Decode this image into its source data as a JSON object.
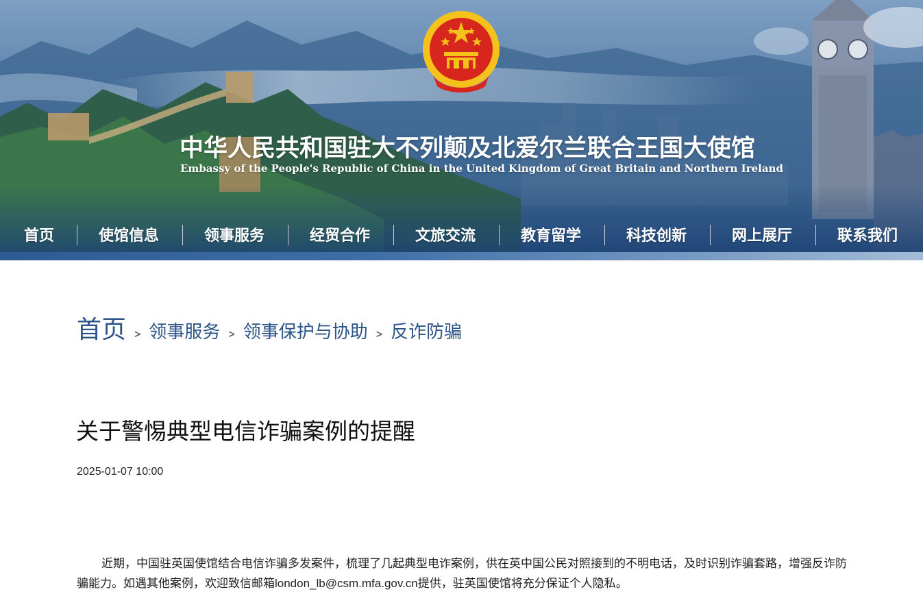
{
  "header": {
    "title_cn": "中华人民共和国驻大不列颠及北爱尔兰联合王国大使馆",
    "title_en": "Embassy of the People's Republic of China in the United Kingdom of Great Britain and Northern Ireland",
    "emblem_icon": "national-emblem-icon"
  },
  "nav": {
    "items": [
      {
        "label": "首页"
      },
      {
        "label": "使馆信息"
      },
      {
        "label": "领事服务"
      },
      {
        "label": "经贸合作"
      },
      {
        "label": "文旅交流"
      },
      {
        "label": "教育留学"
      },
      {
        "label": "科技创新"
      },
      {
        "label": "网上展厅"
      },
      {
        "label": "联系我们"
      }
    ]
  },
  "breadcrumb": {
    "items": [
      {
        "label": "首页"
      },
      {
        "label": "领事服务"
      },
      {
        "label": "领事保护与协助"
      },
      {
        "label": "反诈防骗"
      }
    ],
    "separator": ">"
  },
  "article": {
    "title": "关于警惕典型电信诈骗案例的提醒",
    "date": "2025-01-07 10:00",
    "body": "近期，中国驻英国使馆结合电信诈骗多发案件，梳理了几起典型电诈案例，供在英中国公民对照接到的不明电话，及时识别诈骗套路，增强反诈防骗能力。如遇其他案例，欢迎致信邮箱london_lb@csm.mfa.gov.cn提供，驻英国使馆将充分保证个人隐私。"
  },
  "colors": {
    "breadcrumb_link": "#2c5489",
    "banner_dark": "#1d4274",
    "emblem_red": "#d7261e",
    "emblem_gold": "#f5c21b"
  }
}
